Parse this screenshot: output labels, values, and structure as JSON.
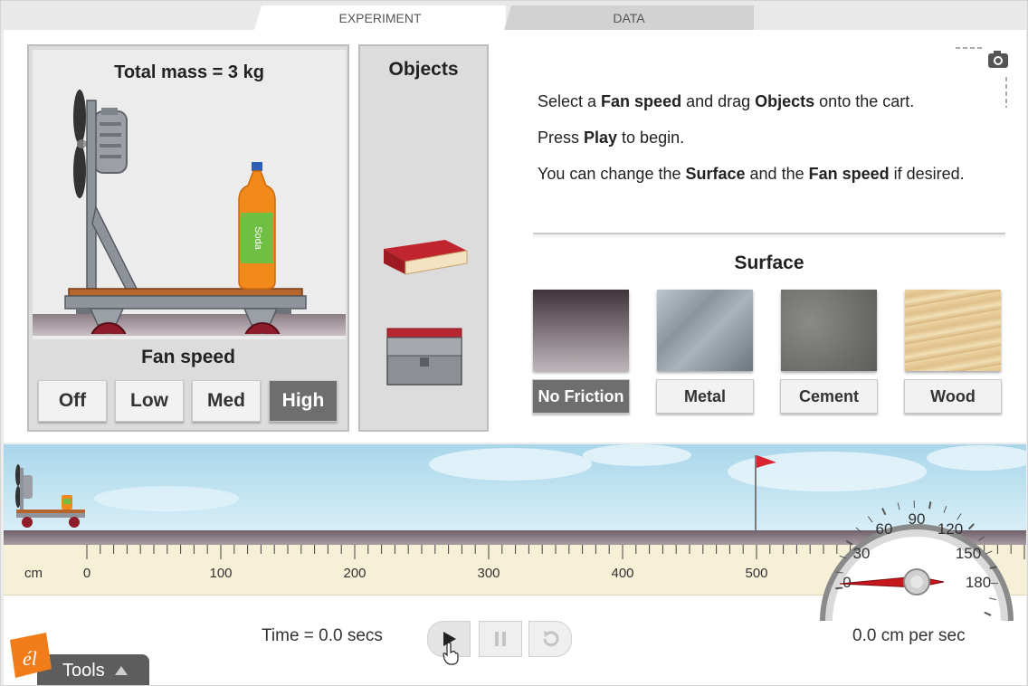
{
  "tabs": [
    {
      "label": "EXPERIMENT",
      "active": true
    },
    {
      "label": "DATA",
      "active": false
    }
  ],
  "cart": {
    "total_mass_label": "Total mass = 3 kg",
    "bottle_label": "Soda"
  },
  "fan_speed": {
    "title": "Fan speed",
    "options": [
      "Off",
      "Low",
      "Med",
      "High"
    ],
    "selected": "High"
  },
  "objects": {
    "title": "Objects",
    "items": [
      "book-icon",
      "toolbox-icon"
    ]
  },
  "instructions": {
    "line1": [
      "Select a ",
      "Fan speed",
      " and drag ",
      "Objects",
      " onto the cart."
    ],
    "line2": [
      "Press ",
      "Play",
      " to begin."
    ],
    "line3": [
      "You can change the ",
      "Surface",
      " and the ",
      "Fan speed",
      " if desired."
    ]
  },
  "surface": {
    "title": "Surface",
    "options": [
      {
        "label": "No Friction",
        "color": "#5a4f56"
      },
      {
        "label": "Metal",
        "color": "#8c979e"
      },
      {
        "label": "Cement",
        "color": "#7a7a78"
      },
      {
        "label": "Wood",
        "color": "#e2c796"
      }
    ],
    "selected": "No Friction"
  },
  "ruler": {
    "unit": "cm",
    "ticks": [
      "0",
      "100",
      "200",
      "300",
      "400",
      "500"
    ]
  },
  "gauge": {
    "ticks": [
      "0",
      "30",
      "60",
      "90",
      "120",
      "150",
      "180"
    ],
    "value": 0,
    "readout": "0.0 cm per sec"
  },
  "playback": {
    "time_readout": "Time = 0.0 secs",
    "buttons": [
      "play-icon",
      "pause-icon",
      "reset-icon"
    ]
  },
  "tools": {
    "label": "Tools",
    "logo_text": "él"
  },
  "colors": {
    "active_button": "#6e6e6e",
    "flag": "#d9252f",
    "gauge_needle": "#c8161d",
    "logo": "#f07d1a"
  }
}
